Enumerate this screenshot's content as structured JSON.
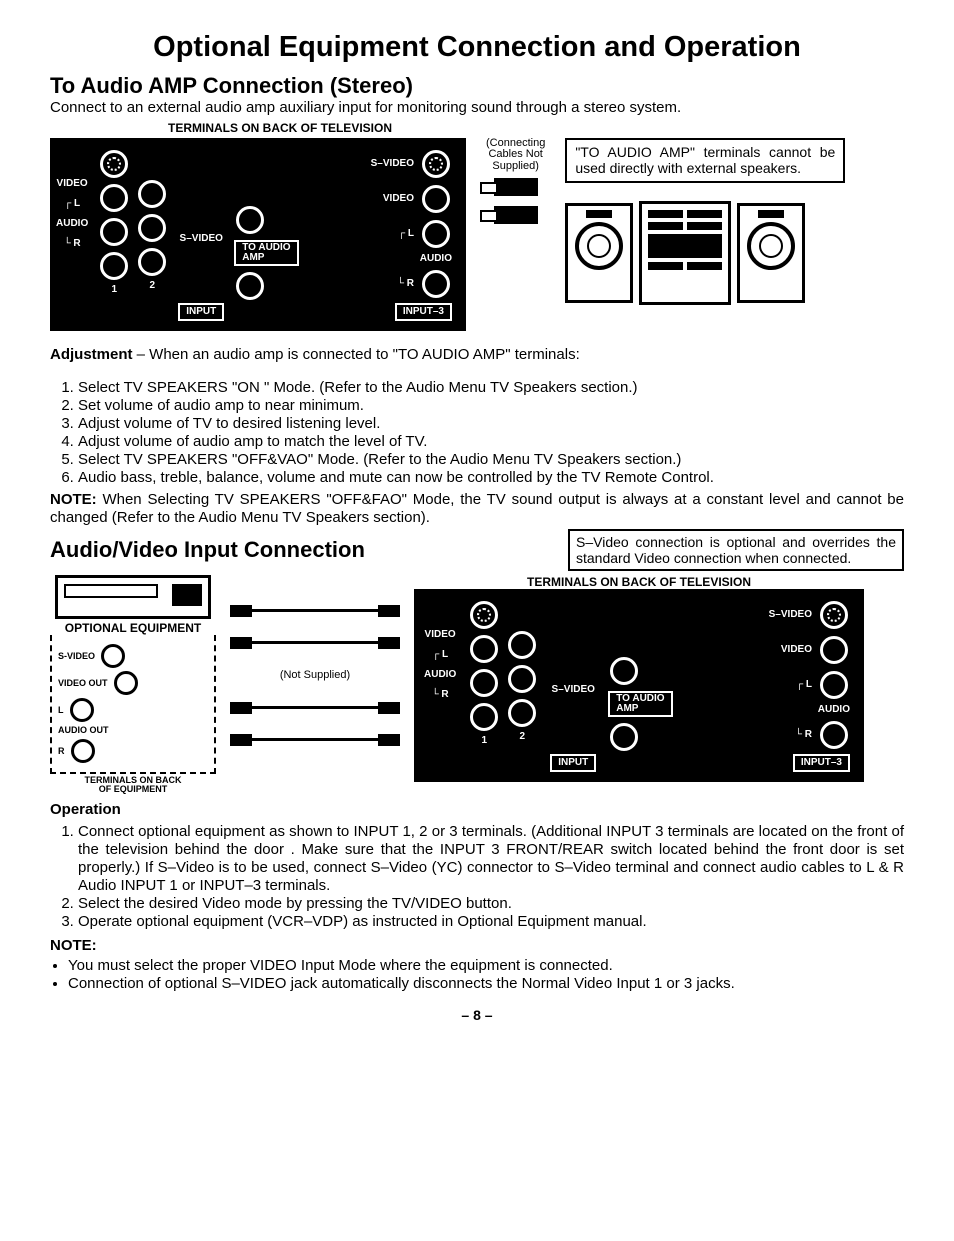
{
  "title": "Optional Equipment Connection and Operation",
  "sec1": {
    "heading": "To Audio AMP Connection (Stereo)",
    "intro": "Connect to an external audio amp auxiliary input for monitoring sound through a stereo system.",
    "panel_caption": "TERMINALS ON BACK OF TELEVISION",
    "labels": {
      "svideo": "S–VIDEO",
      "video": "VIDEO",
      "audio": "AUDIO",
      "l": "L",
      "r": "R",
      "one": "1",
      "two": "2",
      "input": "INPUT",
      "to_audio_amp": "TO AUDIO\nAMP",
      "input3": "INPUT–3",
      "rl": "┌ L",
      "lr": "└ R"
    },
    "cables": "(Connecting\nCables Not\nSupplied)",
    "warn": "\"TO AUDIO AMP\" terminals cannot be used directly with external speakers.",
    "adj_label": "Adjustment",
    "adj_tail": " – When an audio amp is connected to \"TO AUDIO AMP\" terminals:",
    "steps": [
      "Select TV SPEAKERS \"ON \" Mode. (Refer to the Audio Menu TV Speakers section.)",
      "Set volume of audio amp to near minimum.",
      "Adjust volume of TV to desired listening level.",
      "Adjust volume of audio amp to match the level of TV.",
      "Select TV SPEAKERS \"OFF&VAO\" Mode. (Refer to the Audio Menu TV Speakers section.)",
      "Audio bass, treble, balance, volume and mute can now be controlled by the TV Remote Control."
    ],
    "note_label": "NOTE:",
    "note": " When Selecting TV SPEAKERS \"OFF&FAO\" Mode, the TV sound output is always at a constant level and cannot be changed (Refer to the Audio Menu TV Speakers section)."
  },
  "sec2": {
    "heading": "Audio/Video Input Connection",
    "svid_note": "S–Video connection is optional and overrides the standard Video connection when connected.",
    "opt_caption": "OPTIONAL EQUIPMENT",
    "term_caption": "TERMINALS ON BACK OF TELEVISION",
    "eq_labels": {
      "svideo": "S-VIDEO",
      "video_out": "VIDEO OUT",
      "audio_out": "AUDIO OUT",
      "l": "L",
      "r": "R"
    },
    "eq_back": "TERMINALS ON BACK\nOF EQUIPMENT",
    "not_supplied": "(Not Supplied)",
    "op_label": "Operation",
    "op_steps": [
      "Connect optional equipment as shown to INPUT 1, 2 or 3 terminals. (Additional INPUT 3 terminals are located on the front of the television behind the door . Make sure that the INPUT 3 FRONT/REAR switch located behind the front door is set properly.) If S–Video is to be used, connect S–Video (YC) connector to S–Video terminal and connect audio cables to L & R Audio INPUT 1 or INPUT–3 terminals.",
      "Select the desired Video mode by pressing the TV/VIDEO button.",
      "Operate optional equipment (VCR–VDP) as instructed in Optional Equipment manual."
    ],
    "note2_label": "NOTE:",
    "notes2": [
      "You must select the proper VIDEO Input Mode where the equipment is connected.",
      "Connection of optional S–VIDEO jack automatically disconnects the Normal Video Input 1 or 3 jacks."
    ]
  },
  "page": "– 8 –"
}
